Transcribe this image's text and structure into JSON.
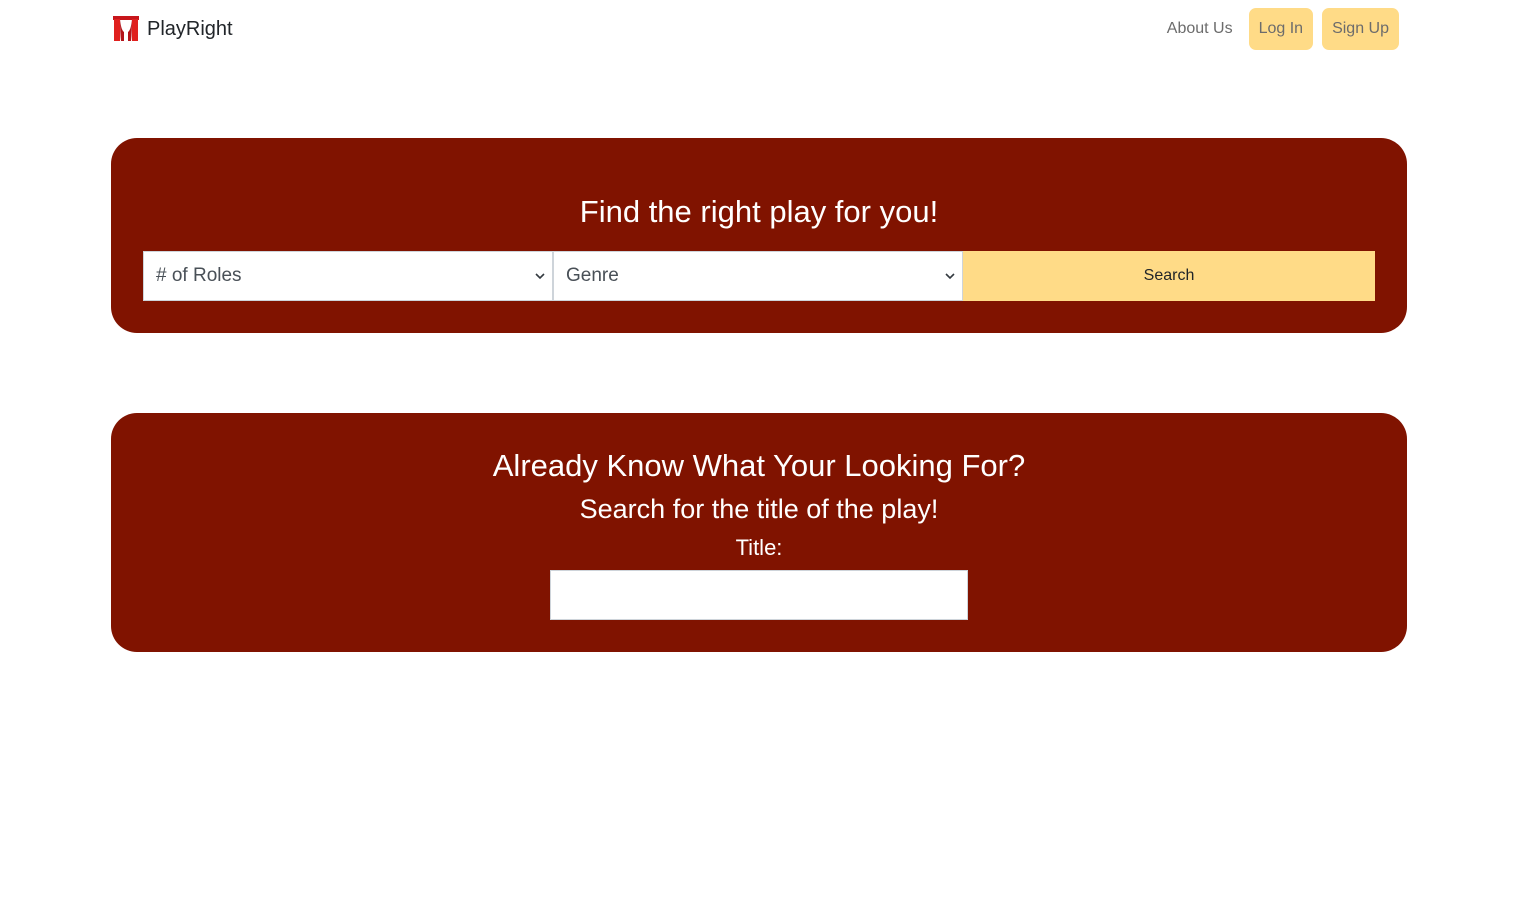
{
  "brand": {
    "name": "PlayRight",
    "logo_icon": "theater-curtain-icon"
  },
  "nav": {
    "about_label": "About Us",
    "login_label": "Log In",
    "signup_label": "Sign Up"
  },
  "finder": {
    "heading": "Find the right play for you!",
    "roles_select": {
      "selected": "# of Roles"
    },
    "genre_select": {
      "selected": "Genre"
    },
    "search_label": "Search"
  },
  "title_search": {
    "heading": "Already Know What Your Looking For?",
    "subheading": "Search for the title of the play!",
    "field_label": "Title:",
    "field_value": ""
  },
  "colors": {
    "panel_bg": "#801300",
    "accent_button": "#ffdb87",
    "logo_red": "#e0201e"
  }
}
